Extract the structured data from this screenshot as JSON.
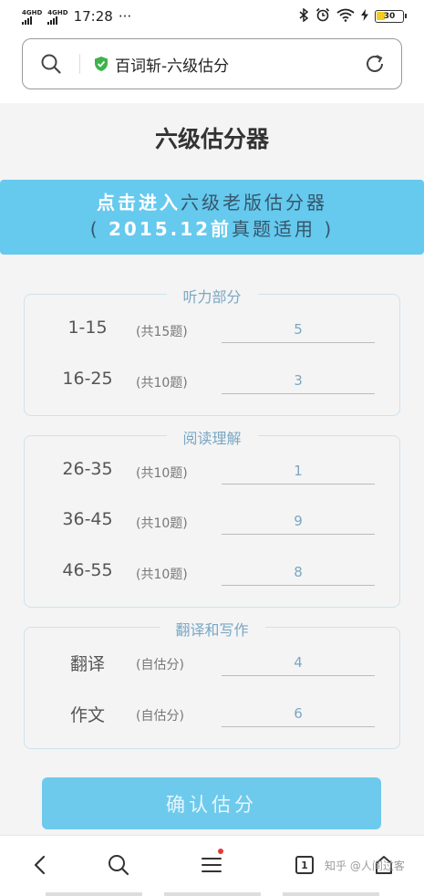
{
  "status_bar": {
    "network_1": "4GHD",
    "network_2": "4GHD",
    "time": "17:28",
    "dots": "···",
    "battery": "30"
  },
  "address_bar": {
    "title": "百词斩-六级估分"
  },
  "page": {
    "title": "六级估分器"
  },
  "banner": {
    "line1_highlight": "点击进入",
    "line1_rest": "六级老版估分器",
    "line2_open": "(",
    "line2_highlight": "2015.12前",
    "line2_rest": "真题适用",
    "line2_close": ")"
  },
  "sections": [
    {
      "legend": "听力部分",
      "rows": [
        {
          "label": "1-15",
          "note": "(共15题)",
          "value": "5"
        },
        {
          "label": "16-25",
          "note": "(共10题)",
          "value": "3"
        }
      ]
    },
    {
      "legend": "阅读理解",
      "rows": [
        {
          "label": "26-35",
          "note": "(共10题)",
          "value": "1"
        },
        {
          "label": "36-45",
          "note": "(共10题)",
          "value": "9"
        },
        {
          "label": "46-55",
          "note": "(共10题)",
          "value": "8"
        }
      ]
    },
    {
      "legend": "翻译和写作",
      "rows": [
        {
          "label": "翻译",
          "note": "(自估分)",
          "value": "4"
        },
        {
          "label": "作文",
          "note": "(自估分)",
          "value": "6"
        }
      ]
    }
  ],
  "confirm_button": "确认估分",
  "bottom_nav": {
    "tabs_count": "1"
  },
  "watermark": "知乎 @人间过客",
  "colors": {
    "accent": "#66c9ee",
    "field_text": "#7aa7c4",
    "section_border": "#cfe2ee"
  }
}
